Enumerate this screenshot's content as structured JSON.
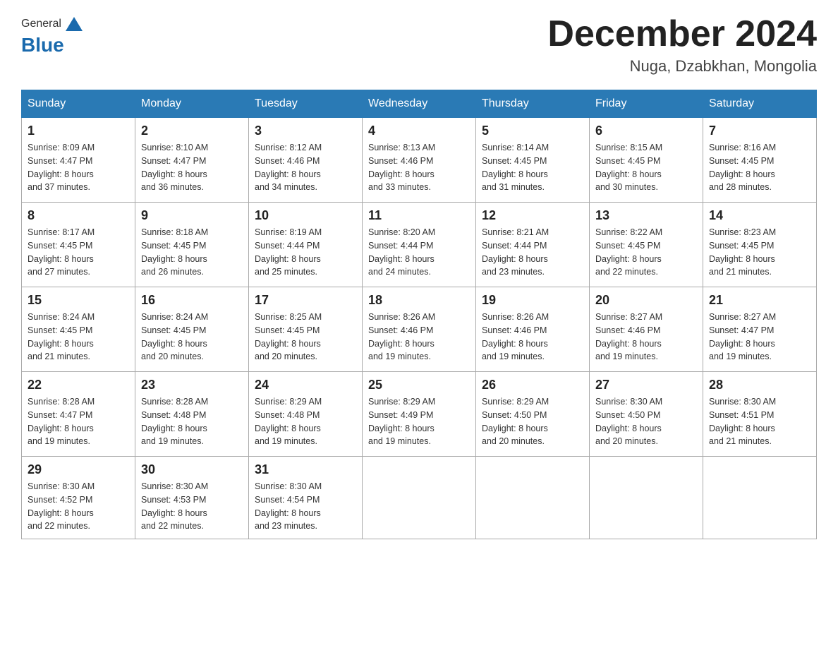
{
  "header": {
    "logo_general": "General",
    "logo_blue": "Blue",
    "month_title": "December 2024",
    "location": "Nuga, Dzabkhan, Mongolia"
  },
  "days_of_week": [
    "Sunday",
    "Monday",
    "Tuesday",
    "Wednesday",
    "Thursday",
    "Friday",
    "Saturday"
  ],
  "weeks": [
    [
      {
        "day": "1",
        "sunrise": "8:09 AM",
        "sunset": "4:47 PM",
        "daylight": "8 hours and 37 minutes."
      },
      {
        "day": "2",
        "sunrise": "8:10 AM",
        "sunset": "4:47 PM",
        "daylight": "8 hours and 36 minutes."
      },
      {
        "day": "3",
        "sunrise": "8:12 AM",
        "sunset": "4:46 PM",
        "daylight": "8 hours and 34 minutes."
      },
      {
        "day": "4",
        "sunrise": "8:13 AM",
        "sunset": "4:46 PM",
        "daylight": "8 hours and 33 minutes."
      },
      {
        "day": "5",
        "sunrise": "8:14 AM",
        "sunset": "4:45 PM",
        "daylight": "8 hours and 31 minutes."
      },
      {
        "day": "6",
        "sunrise": "8:15 AM",
        "sunset": "4:45 PM",
        "daylight": "8 hours and 30 minutes."
      },
      {
        "day": "7",
        "sunrise": "8:16 AM",
        "sunset": "4:45 PM",
        "daylight": "8 hours and 28 minutes."
      }
    ],
    [
      {
        "day": "8",
        "sunrise": "8:17 AM",
        "sunset": "4:45 PM",
        "daylight": "8 hours and 27 minutes."
      },
      {
        "day": "9",
        "sunrise": "8:18 AM",
        "sunset": "4:45 PM",
        "daylight": "8 hours and 26 minutes."
      },
      {
        "day": "10",
        "sunrise": "8:19 AM",
        "sunset": "4:44 PM",
        "daylight": "8 hours and 25 minutes."
      },
      {
        "day": "11",
        "sunrise": "8:20 AM",
        "sunset": "4:44 PM",
        "daylight": "8 hours and 24 minutes."
      },
      {
        "day": "12",
        "sunrise": "8:21 AM",
        "sunset": "4:44 PM",
        "daylight": "8 hours and 23 minutes."
      },
      {
        "day": "13",
        "sunrise": "8:22 AM",
        "sunset": "4:45 PM",
        "daylight": "8 hours and 22 minutes."
      },
      {
        "day": "14",
        "sunrise": "8:23 AM",
        "sunset": "4:45 PM",
        "daylight": "8 hours and 21 minutes."
      }
    ],
    [
      {
        "day": "15",
        "sunrise": "8:24 AM",
        "sunset": "4:45 PM",
        "daylight": "8 hours and 21 minutes."
      },
      {
        "day": "16",
        "sunrise": "8:24 AM",
        "sunset": "4:45 PM",
        "daylight": "8 hours and 20 minutes."
      },
      {
        "day": "17",
        "sunrise": "8:25 AM",
        "sunset": "4:45 PM",
        "daylight": "8 hours and 20 minutes."
      },
      {
        "day": "18",
        "sunrise": "8:26 AM",
        "sunset": "4:46 PM",
        "daylight": "8 hours and 19 minutes."
      },
      {
        "day": "19",
        "sunrise": "8:26 AM",
        "sunset": "4:46 PM",
        "daylight": "8 hours and 19 minutes."
      },
      {
        "day": "20",
        "sunrise": "8:27 AM",
        "sunset": "4:46 PM",
        "daylight": "8 hours and 19 minutes."
      },
      {
        "day": "21",
        "sunrise": "8:27 AM",
        "sunset": "4:47 PM",
        "daylight": "8 hours and 19 minutes."
      }
    ],
    [
      {
        "day": "22",
        "sunrise": "8:28 AM",
        "sunset": "4:47 PM",
        "daylight": "8 hours and 19 minutes."
      },
      {
        "day": "23",
        "sunrise": "8:28 AM",
        "sunset": "4:48 PM",
        "daylight": "8 hours and 19 minutes."
      },
      {
        "day": "24",
        "sunrise": "8:29 AM",
        "sunset": "4:48 PM",
        "daylight": "8 hours and 19 minutes."
      },
      {
        "day": "25",
        "sunrise": "8:29 AM",
        "sunset": "4:49 PM",
        "daylight": "8 hours and 19 minutes."
      },
      {
        "day": "26",
        "sunrise": "8:29 AM",
        "sunset": "4:50 PM",
        "daylight": "8 hours and 20 minutes."
      },
      {
        "day": "27",
        "sunrise": "8:30 AM",
        "sunset": "4:50 PM",
        "daylight": "8 hours and 20 minutes."
      },
      {
        "day": "28",
        "sunrise": "8:30 AM",
        "sunset": "4:51 PM",
        "daylight": "8 hours and 21 minutes."
      }
    ],
    [
      {
        "day": "29",
        "sunrise": "8:30 AM",
        "sunset": "4:52 PM",
        "daylight": "8 hours and 22 minutes."
      },
      {
        "day": "30",
        "sunrise": "8:30 AM",
        "sunset": "4:53 PM",
        "daylight": "8 hours and 22 minutes."
      },
      {
        "day": "31",
        "sunrise": "8:30 AM",
        "sunset": "4:54 PM",
        "daylight": "8 hours and 23 minutes."
      },
      null,
      null,
      null,
      null
    ]
  ],
  "labels": {
    "sunrise": "Sunrise:",
    "sunset": "Sunset:",
    "daylight": "Daylight:"
  }
}
